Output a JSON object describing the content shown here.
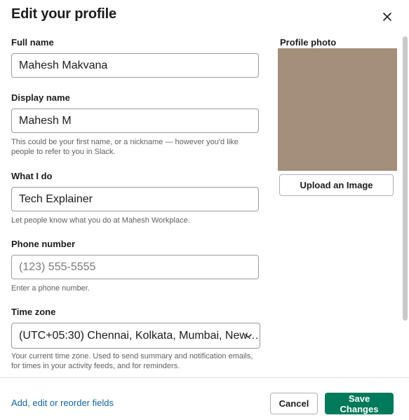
{
  "dialog": {
    "title": "Edit your profile",
    "close_icon": "close-icon"
  },
  "fields": {
    "full_name": {
      "label": "Full name",
      "value": "Mahesh Makvana"
    },
    "display_name": {
      "label": "Display name",
      "value": "Mahesh M",
      "hint": "This could be your first name, or a nickname — however you'd like people to refer to you in Slack."
    },
    "what_i_do": {
      "label": "What I do",
      "value": "Tech Explainer",
      "hint": "Let people know what you do at Mahesh Workplace."
    },
    "phone": {
      "label": "Phone number",
      "value": "",
      "placeholder": "(123) 555-5555",
      "hint": "Enter a phone number."
    },
    "time_zone": {
      "label": "Time zone",
      "value": "(UTC+05:30) Chennai, Kolkata, Mumbai, New…",
      "hint": "Your current time zone. Used to send summary and notification emails, for times in your activity feeds, and for reminders.",
      "icon": "chevron-down-icon"
    }
  },
  "photo": {
    "label": "Profile photo",
    "upload_label": "Upload an Image",
    "color": "#a38f7a"
  },
  "footer": {
    "link_label": "Add, edit or reorder fields",
    "cancel_label": "Cancel",
    "save_label": "Save Changes"
  },
  "colors": {
    "accent": "#007a5a",
    "link": "#1264a3"
  }
}
